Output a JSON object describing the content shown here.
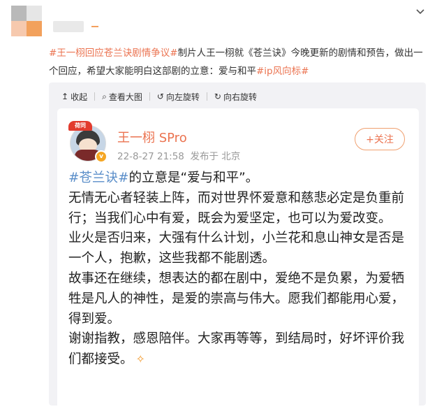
{
  "colors": {
    "accent_orange": "#eb7350",
    "hashtag_blue": "#5a8ec9",
    "meta_gray": "#999999",
    "viewer_bg": "#f2f2f5"
  },
  "post": {
    "text_parts": [
      {
        "text": "#王一栩回应苍兰诀剧情争议#",
        "is_tag": true
      },
      {
        "text": "制片人王一栩就《苍兰诀》今晚更新的剧情和预告，做出一个回应，希望大家能明白这部剧的立意：爱与和平",
        "is_tag": false
      },
      {
        "text": "#ip风向标#",
        "is_tag": true
      }
    ],
    "collapse_icon": "chevron-down-icon"
  },
  "toolbar": {
    "items": [
      {
        "icon": "↥",
        "label": "收起"
      },
      {
        "icon": "⌕",
        "label": "查看大图"
      },
      {
        "icon": "↺",
        "label": "向左旋转"
      },
      {
        "icon": "↻",
        "label": "向右旋转"
      }
    ]
  },
  "card": {
    "avatar_hat_text": "荷同",
    "verified_badge": "v",
    "username": "王一栩 SPro",
    "date": "22-8-27 21:58",
    "published_in": "发布于 北京",
    "follow_label": "+关注",
    "body": {
      "tag": "#苍兰诀#",
      "first_line_rest": "的立意是“爱与和平”。",
      "lines": [
        "无情无心者轻装上阵，而对世界怀爱意和慈悲必定是负重前行；当我们心中有爱，既会为爱坚定，也可以为爱改变。",
        "业火是否归来，大强有什么计划，小兰花和息山神女是否是一个人，抱歉，这些我都不能剧透。",
        "故事还在继续，想表达的都在剧中，爱绝不是负累，为爱牺牲是凡人的神性，是爱的崇高与伟大。愿我们都能用心爱，得到爱。",
        "谢谢指教，感恩陪伴。大家再等等，到结局时，好坏评价我们都接受。"
      ],
      "end_emoji": "cheers-emoji"
    }
  }
}
